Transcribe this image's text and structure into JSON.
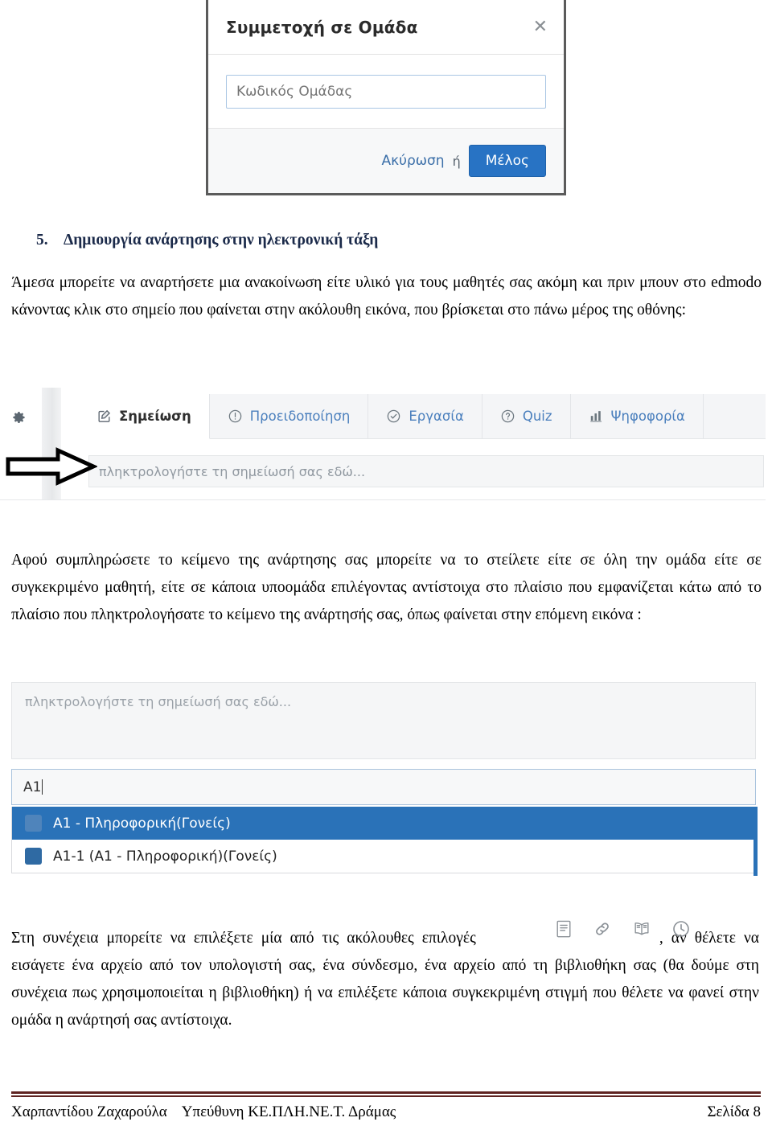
{
  "dialog": {
    "title": "Συμμετοχή σε Ομάδα",
    "close_icon": "close-icon",
    "input_placeholder": "Κωδικός Ομάδας",
    "input_value": "",
    "cancel_label": "Ακύρωση",
    "or_label": "ή",
    "primary_label": "Μέλος",
    "primary_color": "#2873c4"
  },
  "section": {
    "number": "5.",
    "heading": "Δημιουργία ανάρτησης στην ηλεκτρονική τάξη",
    "heading_color": "#1b2a4a"
  },
  "paragraphs": {
    "p1": "Άμεσα μπορείτε να αναρτήσετε μια ανακοίνωση είτε υλικό για τους μαθητές σας ακόμη και πριν μπουν στο edmodo κάνοντας κλικ στο σημείο που φαίνεται στην ακόλουθη εικόνα, που βρίσκεται στο πάνω μέρος της οθόνης:",
    "p2": "Αφού συμπληρώσετε το κείμενο της ανάρτησης σας μπορείτε να το στείλετε είτε σε όλη την ομάδα είτε σε συγκεκριμένο μαθητή, είτε σε κάποια υποομάδα επιλέγοντας αντίστοιχα στο πλαίσιο που εμφανίζεται κάτω από το πλαίσιο που πληκτρολογήσατε το κείμενο της ανάρτησής σας, όπως φαίνεται στην επόμενη εικόνα :",
    "p3_before": "Στη συνέχεια μπορείτε να επιλέξετε μία από τις ακόλουθες επιλογές",
    "p3_after": ", αν θέλετε να εισάγετε ένα αρχείο από τον υπολογιστή σας, ένα σύνδεσμο, ένα αρχείο από τη βιβλιοθήκη σας (θα δούμε στη συνέχεια πως χρησιμοποιείται η βιβλιοθήκη) ή να επιλέξετε κάποια συγκεκριμένη στιγμή που θέλετε να φανεί στην ομάδα η ανάρτησή σας αντίστοιχα."
  },
  "toolbar": {
    "gear_icon": "gear-icon",
    "tabs": [
      {
        "label": "Σημείωση",
        "icon": "note-pencil-icon",
        "active": true
      },
      {
        "label": "Προειδοποίηση",
        "icon": "alert-exclamation-icon",
        "active": false
      },
      {
        "label": "Εργασία",
        "icon": "check-circle-icon",
        "active": false
      },
      {
        "label": "Quiz",
        "icon": "question-circle-icon",
        "active": false
      },
      {
        "label": "Ψηφοφορία",
        "icon": "bar-chart-icon",
        "active": false
      }
    ],
    "composer_placeholder": "πληκτρολογήστε τη σημείωσή σας εδώ...",
    "annotation_icon": "right-arrow-annotation"
  },
  "post_box": {
    "note_placeholder": "πληκτρολογήστε τη σημείωσή σας εδώ...",
    "combo_value": "A1",
    "options": [
      {
        "label": "A1 - Πληροφορική(Γονείς)",
        "selected": true
      },
      {
        "label": "A1-1 (A1 - Πληροφορική)(Γονείς)",
        "selected": false
      }
    ],
    "highlight_color": "#2a72b8"
  },
  "attachment_icons": [
    {
      "name": "file-document-icon"
    },
    {
      "name": "link-chain-icon"
    },
    {
      "name": "library-book-icon"
    },
    {
      "name": "clock-schedule-icon"
    }
  ],
  "footer": {
    "author": "Χαρπαντίδου Ζαχαρούλα",
    "role": "Υπεύθυνη ΚΕ.ΠΛΗ.ΝΕ.Τ. Δράμας",
    "page": "Σελίδα 8",
    "rule_color": "#5e2220"
  }
}
